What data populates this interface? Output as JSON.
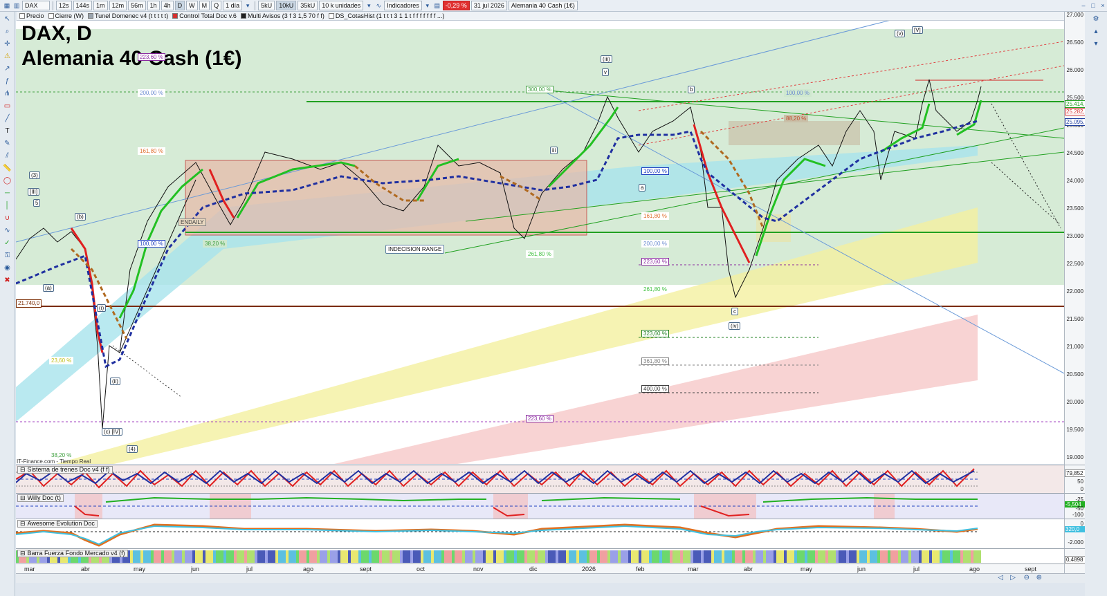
{
  "toolbar": {
    "symbol": "DAX",
    "timeframes": [
      "12s",
      "144s",
      "1m",
      "12m",
      "56m",
      "1h",
      "4h",
      "D",
      "W",
      "M",
      "Q"
    ],
    "active_timeframe": "D",
    "period": "1 día",
    "units": [
      "5kU",
      "10kU",
      "35kU"
    ],
    "active_unit": "10kU",
    "volume": "10 k unidades",
    "indicators_label": "Indicadores",
    "change": "-0,29 %",
    "date": "31 jul 2026",
    "instrument": "Alemania 40 Cash (1€)"
  },
  "studies": [
    {
      "label": "Precio",
      "color": "#ffffff"
    },
    {
      "label": "Cierre (W)",
      "color": "#ffffff"
    },
    {
      "label": "Tunel Domenec v4 (t t t t t)",
      "color": "#9aa4ae"
    },
    {
      "label": "Control Total Doc v.6",
      "color": "#d43030"
    },
    {
      "label": "Multi Avisos (3 f 3 1,5 70 f f)",
      "color": "#222222"
    },
    {
      "label": "DS_CotasHist (1 t t t 3 1 1 t f f f f f f f ...)",
      "color": "#ffffff"
    }
  ],
  "chart": {
    "title": "DAX, D",
    "subtitle": "Alemania 40 Cash (1€)",
    "watermark": "IT-Finance.com - Tiempo Real",
    "price_axis": [
      "27.000",
      "26.500",
      "26.000",
      "25.500",
      "25.000",
      "24.500",
      "24.000",
      "23.500",
      "23.000",
      "22.500",
      "22.000",
      "21.500",
      "21.000",
      "20.500",
      "20.000",
      "19.500",
      "19.000"
    ],
    "price_tags": [
      {
        "label": "25.414,9",
        "color": "#22a022"
      },
      {
        "label": "25.282,4",
        "color": "#d43030"
      },
      {
        "label": "25.095,0",
        "color": "#1f3fa0"
      }
    ],
    "level_label": "21.740,0",
    "fib_labels": [
      {
        "text": "223,60 %",
        "color": "#8a2aa0"
      },
      {
        "text": "200,00 %",
        "color": "#6a8ad0"
      },
      {
        "text": "161,80 %",
        "color": "#e07030"
      },
      {
        "text": "100,00 %",
        "color": "#2040c0"
      },
      {
        "text": "38,20 %",
        "color": "#40a040"
      },
      {
        "text": "23,60 %",
        "color": "#c0c020"
      },
      {
        "text": "38,20 %",
        "color": "#40a040"
      },
      {
        "text": "300,00 %",
        "color": "#40a040"
      },
      {
        "text": "261,80 %",
        "color": "#40c040"
      },
      {
        "text": "100,00 %",
        "color": "#2040c0"
      },
      {
        "text": "161,80 %",
        "color": "#e07030"
      },
      {
        "text": "200,00 %",
        "color": "#6a8ad0"
      },
      {
        "text": "223,60 %",
        "color": "#8a2aa0"
      },
      {
        "text": "261,80 %",
        "color": "#40c040"
      },
      {
        "text": "323,60 %",
        "color": "#208020"
      },
      {
        "text": "361,80 %",
        "color": "#808080"
      },
      {
        "text": "400,00 %",
        "color": "#404040"
      },
      {
        "text": "223,60 %",
        "color": "#8a2aa0"
      },
      {
        "text": "88,20 %",
        "color": "#c05030"
      },
      {
        "text": "100,00 %",
        "color": "#6a8ad0"
      }
    ],
    "wave_labels": [
      "(3)",
      "[III]",
      "5",
      "(b)",
      "(a)",
      "(i)",
      "(ii)",
      "(c) [IV]",
      "(4)",
      "(iii)",
      "v",
      "iii",
      "b",
      "a",
      "c",
      "(iv)",
      "(v)",
      "[V]"
    ],
    "box_labels": [
      "INDECISION RANGE",
      "ENDAILY"
    ]
  },
  "panes": [
    {
      "name": "Sistema de trenes Doc v4 (f f)",
      "axis_top": "79,852",
      "axis_mid": "50",
      "axis_bot": "0"
    },
    {
      "name": "Willy Doc (t)",
      "axis_top": "-25",
      "axis_tag": "-5,504",
      "axis_mid": "-50",
      "axis_bot": "-100"
    },
    {
      "name": "Awesome Evolution Doc",
      "axis_top": "0",
      "axis_tag": "320,0",
      "axis_bot": "-2.000"
    },
    {
      "name": "Barra Fuerza Fondo Mercado v4 (f)",
      "axis_tag": "0,4898"
    }
  ],
  "x_axis": [
    "mar",
    "abr",
    "may",
    "jun",
    "jul",
    "ago",
    "sept",
    "oct",
    "nov",
    "dic",
    "2026",
    "feb",
    "mar",
    "abr",
    "may",
    "jun",
    "jul",
    "ago",
    "sept"
  ],
  "colors": {
    "bull": "#22c022",
    "bear": "#e02020",
    "support_line": "#7a2a00",
    "zone_green": "#cfe8cf",
    "zone_red": "#e8b8a8"
  }
}
